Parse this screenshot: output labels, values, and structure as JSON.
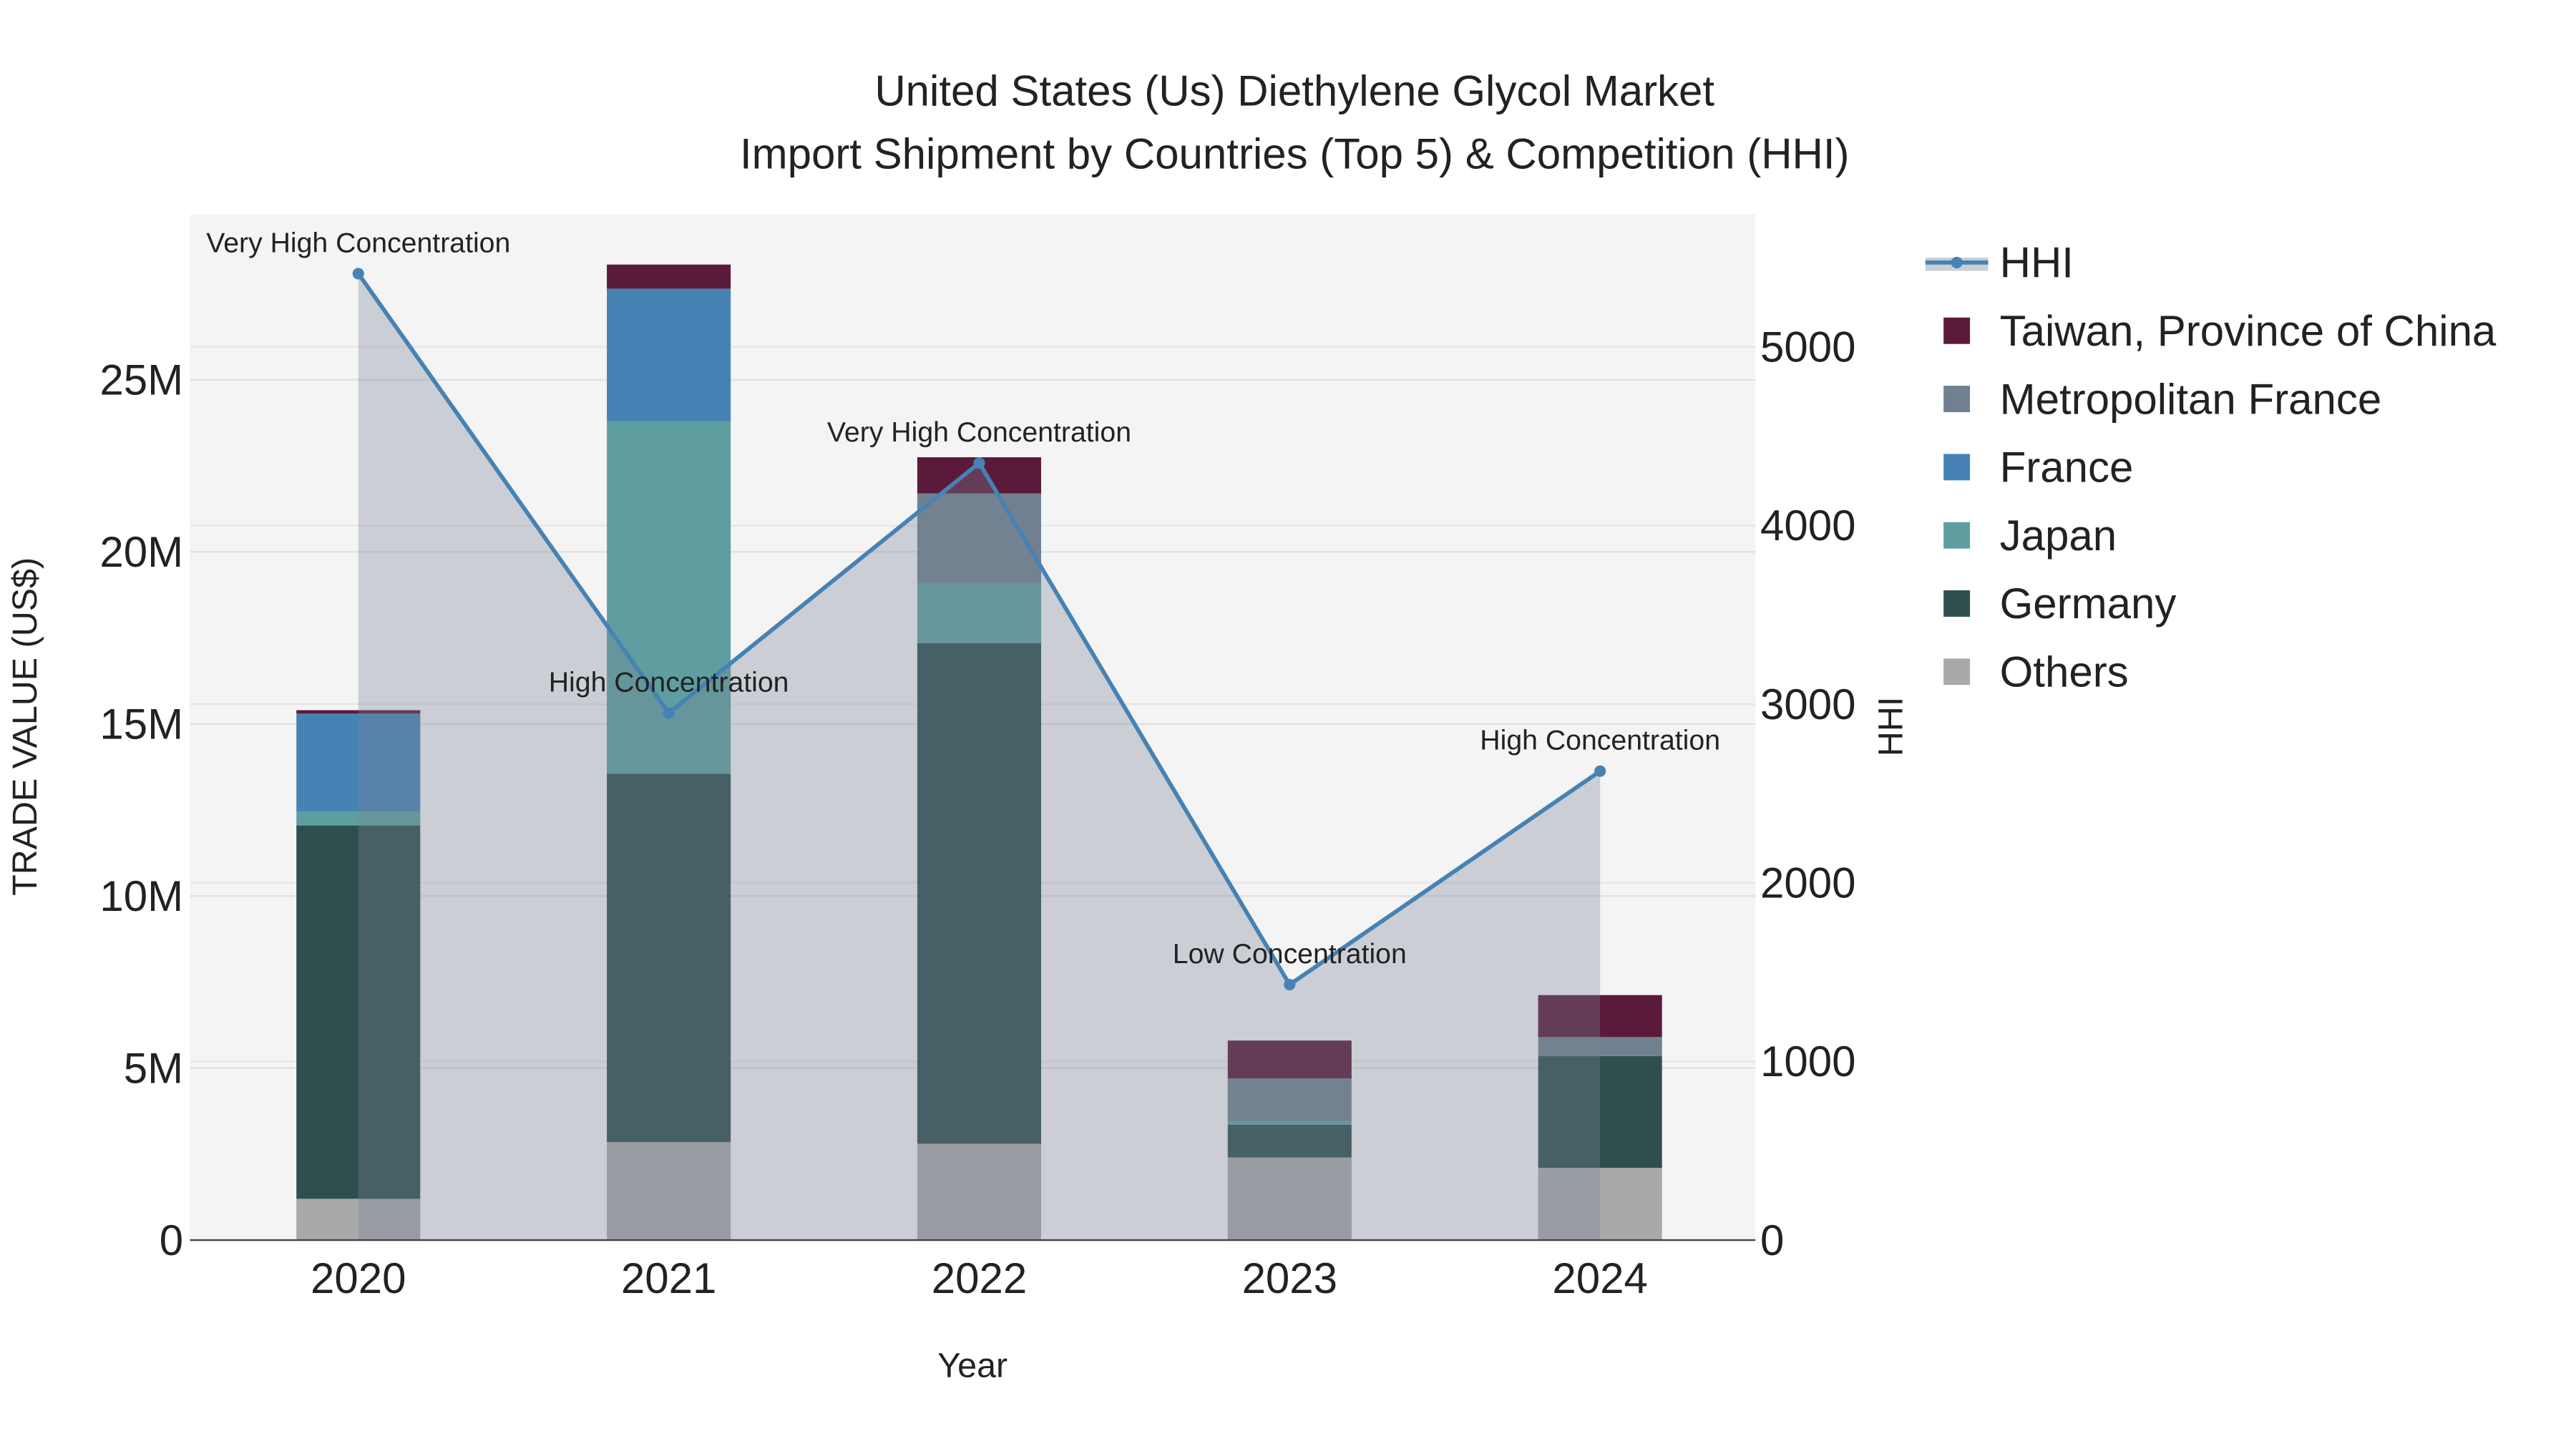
{
  "chart_data": {
    "type": "bar",
    "title": "United States (Us) Diethylene Glycol Market",
    "subtitle": "Import Shipment by Countries (Top 5) & Competition (HHI)",
    "xlabel": "Year",
    "ylabel": "TRADE VALUE (US$)",
    "y2label": "HHI",
    "categories": [
      "2020",
      "2021",
      "2022",
      "2023",
      "2024"
    ],
    "ylim": [
      0,
      29.8
    ],
    "y_unit": "M",
    "yticks": [
      0,
      5,
      10,
      15,
      20,
      25
    ],
    "ytick_labels": [
      "0",
      "5M",
      "10M",
      "15M",
      "20M",
      "25M"
    ],
    "y2lim": [
      0,
      5740
    ],
    "y2ticks": [
      0,
      1000,
      2000,
      3000,
      4000,
      5000
    ],
    "y2tick_labels": [
      "0",
      "1000",
      "2000",
      "3000",
      "4000",
      "5000"
    ],
    "grid": true,
    "barmode": "stack",
    "legend_position": "right",
    "series": [
      {
        "name": "Others",
        "color": "#a9a9a9",
        "values": [
          1.2,
          2.85,
          2.8,
          2.4,
          2.1
        ]
      },
      {
        "name": "Germany",
        "color": "#2f4f4f",
        "values": [
          10.85,
          10.7,
          14.55,
          0.95,
          3.25
        ]
      },
      {
        "name": "Japan",
        "color": "#5f9ea0",
        "values": [
          0.4,
          10.25,
          1.75,
          0.1,
          0
        ]
      },
      {
        "name": "France",
        "color": "#4682b4",
        "values": [
          2.85,
          3.85,
          0,
          0,
          0
        ]
      },
      {
        "name": "Metropolitan France",
        "color": "#708090",
        "values": [
          0,
          0,
          2.6,
          1.25,
          0.55
        ]
      },
      {
        "name": "Taiwan, Province of China",
        "color": "#5c1a3a",
        "values": [
          0.1,
          0.7,
          1.05,
          1.1,
          1.22
        ]
      }
    ],
    "hhi": {
      "name": "HHI",
      "color": "#4682b4",
      "values": [
        5410,
        2950,
        4350,
        1430,
        2625
      ],
      "annotations": [
        "Very High Concentration",
        "High Concentration",
        "Very High Concentration",
        "Low Concentration",
        "High Concentration"
      ]
    },
    "legend_order": [
      "HHI",
      "Taiwan, Province of China",
      "Metropolitan France",
      "France",
      "Japan",
      "Germany",
      "Others"
    ]
  }
}
